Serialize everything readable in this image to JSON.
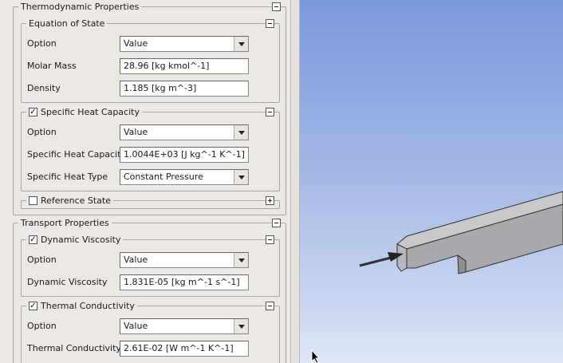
{
  "thermo": {
    "title": "Thermodynamic Properties",
    "eos": {
      "title": "Equation of State",
      "option_label": "Option",
      "option_value": "Value",
      "molar_mass_label": "Molar Mass",
      "molar_mass_value": "28.96 [kg kmol^-1]",
      "density_label": "Density",
      "density_value": "1.185 [kg m^-3]"
    },
    "heat": {
      "title": "Specific Heat Capacity",
      "enabled": true,
      "option_label": "Option",
      "option_value": "Value",
      "cp_label": "Specific Heat Capacity",
      "cp_value": "1.0044E+03 [J kg^-1 K^-1]",
      "type_label": "Specific Heat Type",
      "type_value": "Constant Pressure"
    },
    "reference": {
      "title": "Reference State",
      "enabled": false
    }
  },
  "transport": {
    "title": "Transport Properties",
    "viscosity": {
      "title": "Dynamic Viscosity",
      "enabled": true,
      "option_label": "Option",
      "option_value": "Value",
      "value_label": "Dynamic Viscosity",
      "value": "1.831E-05 [kg m^-1 s^-1]"
    },
    "conductivity": {
      "title": "Thermal Conductivity",
      "enabled": true,
      "option_label": "Option",
      "option_value": "Value",
      "value_label": "Thermal Conductivity",
      "value": "2.61E-02 [W m^-1 K^-1]"
    }
  },
  "icons": {
    "collapse": "minus-box-icon",
    "expand": "plus-box-icon",
    "check": "✓",
    "dropdown": "chevron-down-icon",
    "cursor": "mouse-pointer-icon"
  },
  "colors": {
    "panel_bg": "#ece9e4",
    "viewport_top": "#7a98dc",
    "viewport_bottom": "#dde5f7",
    "geometry": "#b8b8bb"
  }
}
